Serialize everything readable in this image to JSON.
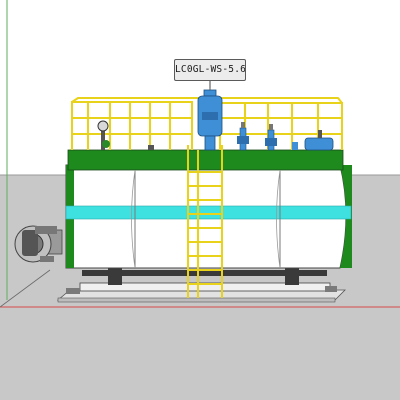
{
  "model_label": "LC0GL-WS-5.6",
  "colors": {
    "sky": "#ffffff",
    "ground": "#c8c8c8",
    "shell": "#ffffff",
    "top_band": "#1e8a1e",
    "stripe": "#3fe0e0",
    "railing": "#e8d21a",
    "valve": "#3f8fd6",
    "frame": "#3a3a3a"
  }
}
